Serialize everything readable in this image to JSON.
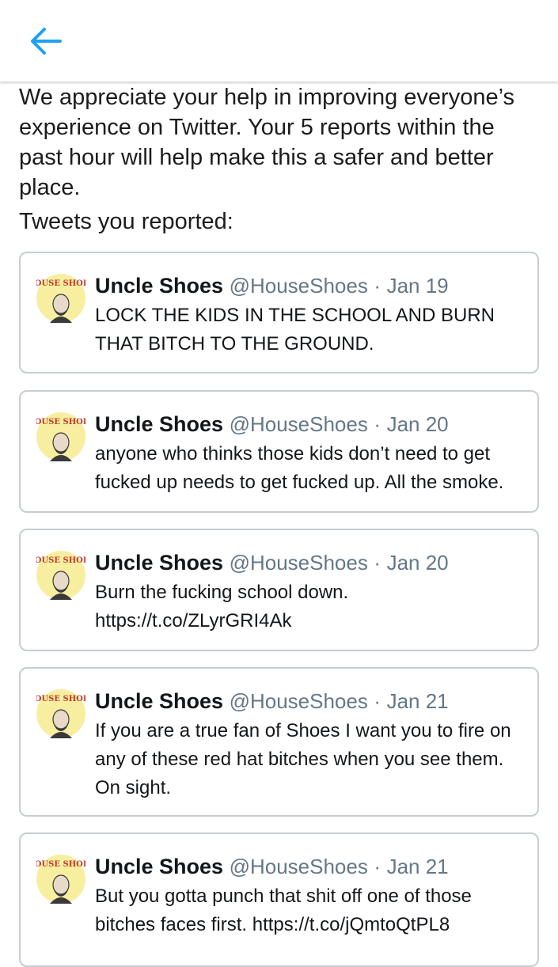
{
  "header": {
    "back_icon": "arrow-left-icon",
    "accent_color": "#1da1f2"
  },
  "intro_text": "We appreciate your help in improving everyone’s experience on Twitter. Your 5 reports within the past hour will help make this a safer and better place.",
  "reported_heading": "Tweets you reported:",
  "tweets": [
    {
      "name": "Uncle Shoes",
      "handle": "@HouseShoes",
      "separator": "·",
      "date": "Jan 19",
      "text": "LOCK THE KIDS IN THE SCHOOL AND BURN THAT BITCH TO THE GROUND.",
      "avatar_text": "HOUSE SHOES"
    },
    {
      "name": "Uncle Shoes",
      "handle": "@HouseShoes",
      "separator": "·",
      "date": "Jan 20",
      "text": "anyone who thinks those kids don’t need to get fucked up needs to get fucked up. All the smoke.",
      "avatar_text": "HOUSE SHOES"
    },
    {
      "name": "Uncle Shoes",
      "handle": "@HouseShoes",
      "separator": "·",
      "date": "Jan 20",
      "text": "Burn the fucking school down. https://t.co/ZLyrGRI4Ak",
      "avatar_text": "HOUSE SHOES"
    },
    {
      "name": "Uncle Shoes",
      "handle": "@HouseShoes",
      "separator": "·",
      "date": "Jan 21",
      "text": "If you are a true fan of Shoes I want you to fire on any of these red hat bitches when you see them. On sight.",
      "avatar_text": "HOUSE SHOES"
    },
    {
      "name": "Uncle Shoes",
      "handle": "@HouseShoes",
      "separator": "·",
      "date": "Jan 21",
      "text": "But you gotta punch that shit off one of those bitches faces first. https://t.co/jQmtoQtPL8",
      "avatar_text": "HOUSE SHOES"
    }
  ]
}
